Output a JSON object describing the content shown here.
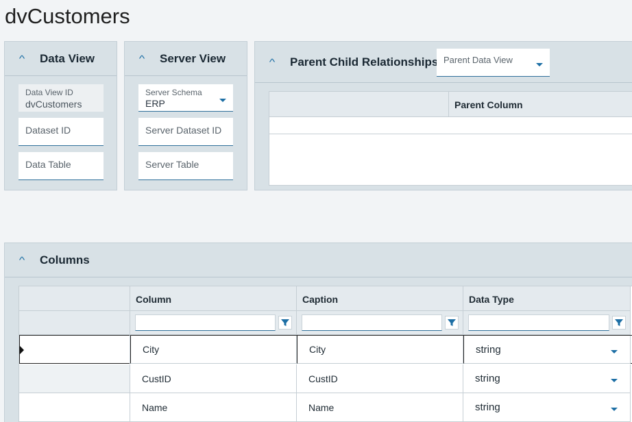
{
  "page_title": "dvCustomers",
  "data_view": {
    "title": "Data View",
    "data_view_id_label": "Data View ID",
    "data_view_id_value": "dvCustomers",
    "dataset_id_placeholder": "Dataset ID",
    "data_table_placeholder": "Data Table"
  },
  "server_view": {
    "title": "Server View",
    "schema_label": "Server Schema",
    "schema_value": "ERP",
    "server_dataset_id_placeholder": "Server Dataset ID",
    "server_table_placeholder": "Server Table"
  },
  "parent_child": {
    "title": "Parent Child Relationships",
    "parent_data_view_label": "Parent Data View",
    "grid_header_parent_column": "Parent Column"
  },
  "columns": {
    "title": "Columns",
    "headers": [
      "Column",
      "Caption",
      "Data Type"
    ],
    "rows": [
      {
        "column": "City",
        "caption": "City",
        "data_type": "string"
      },
      {
        "column": "CustID",
        "caption": "CustID",
        "data_type": "string"
      },
      {
        "column": "Name",
        "caption": "Name",
        "data_type": "string"
      }
    ]
  },
  "colors": {
    "accent": "#1d6fa5",
    "panel_bg": "#d8e1e6",
    "page_bg": "#f2f4f6"
  }
}
